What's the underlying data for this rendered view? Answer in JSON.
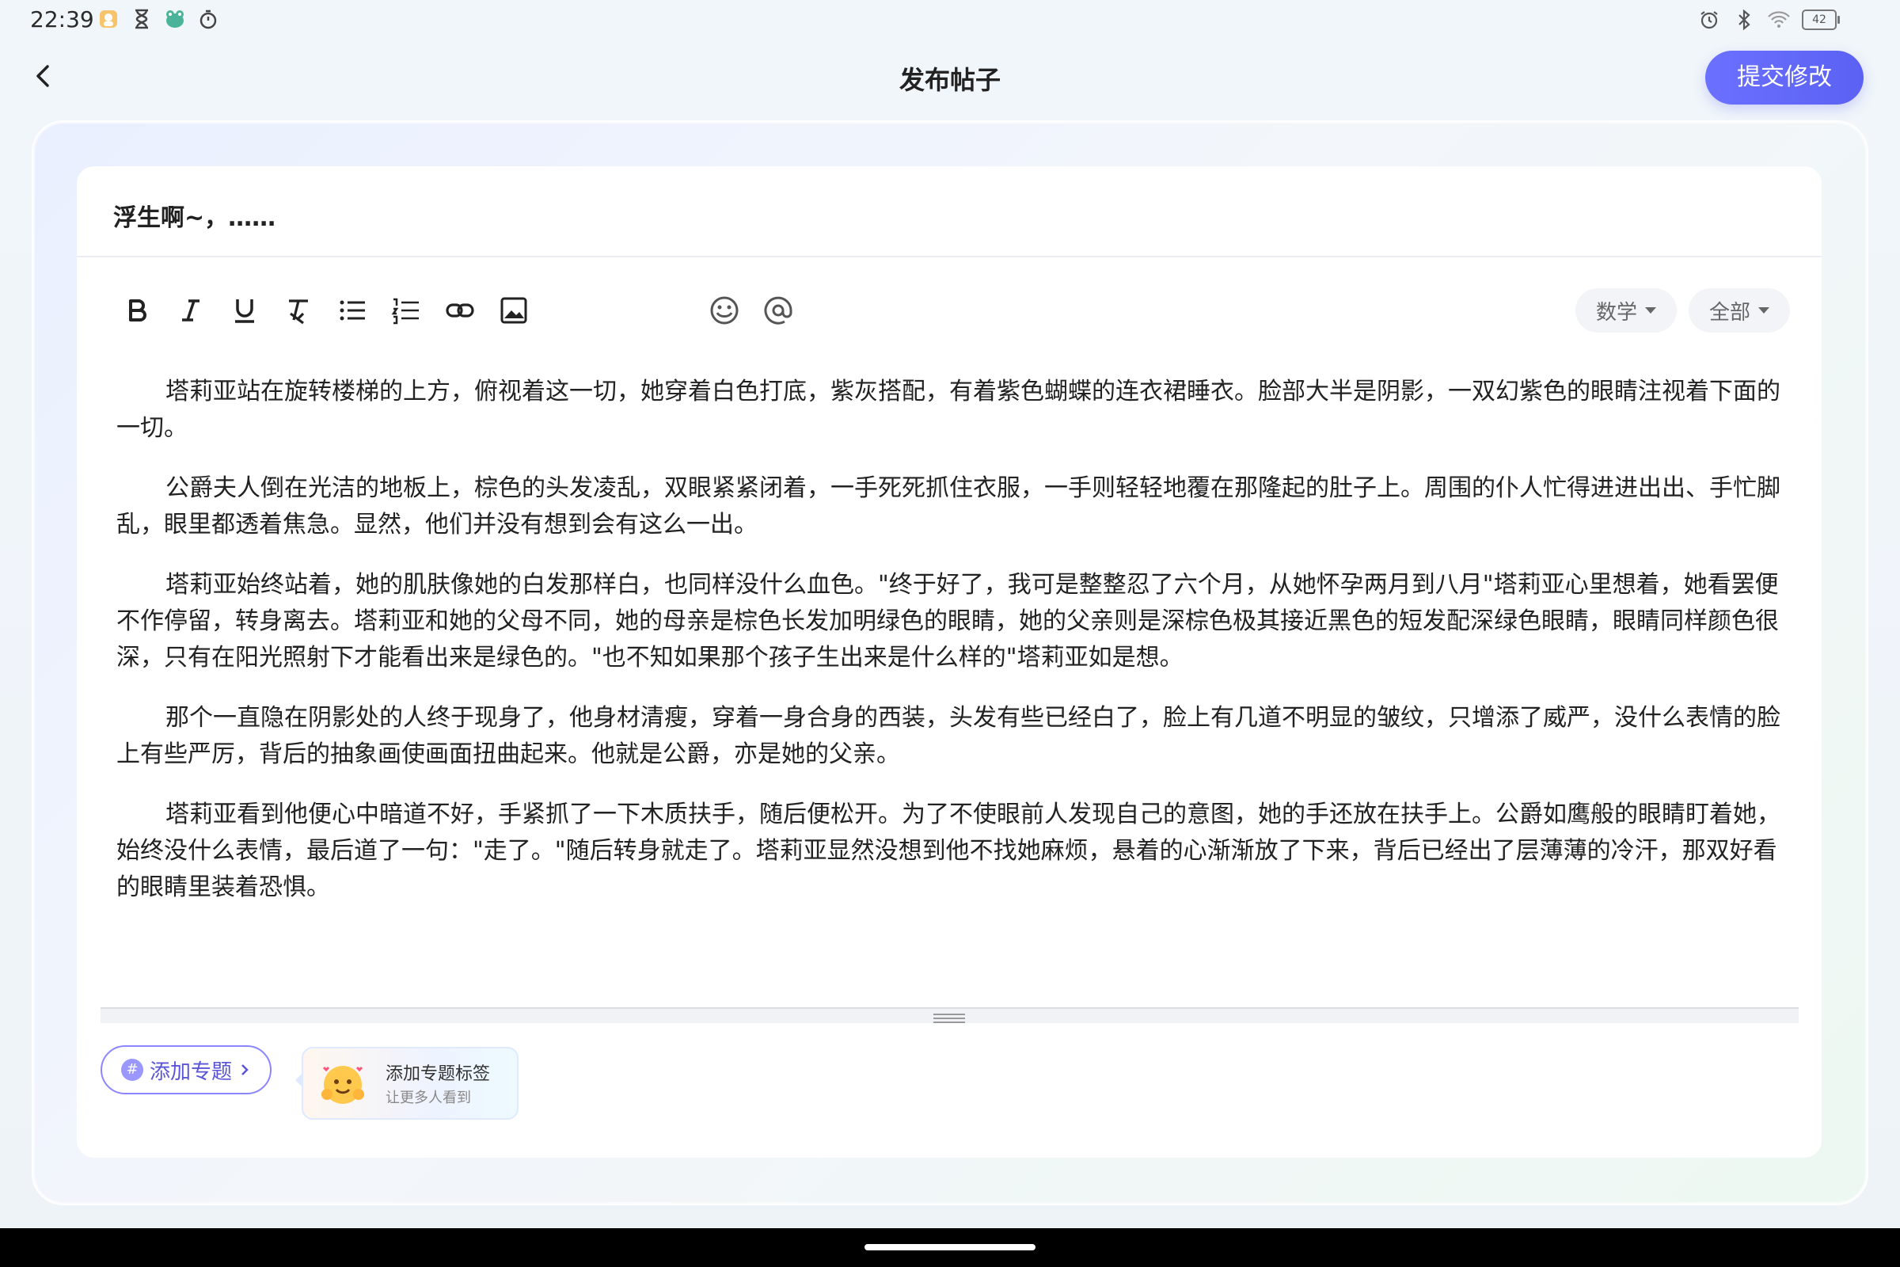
{
  "status": {
    "time": "22:39",
    "battery": "42",
    "left_icons": [
      "app-notification-icon",
      "hourglass-icon",
      "frog-icon",
      "timer-icon"
    ],
    "right_icons": [
      "alarm-icon",
      "bluetooth-icon",
      "wifi-icon",
      "battery-icon"
    ]
  },
  "header": {
    "title": "发布帖子",
    "submit_label": "提交修改"
  },
  "post": {
    "title": "浮生啊~，……",
    "paragraphs": [
      "塔莉亚站在旋转楼梯的上方，俯视着这一切，她穿着白色打底，紫灰搭配，有着紫色蝴蝶的连衣裙睡衣。脸部大半是阴影，一双幻紫色的眼睛注视着下面的一切。",
      "公爵夫人倒在光洁的地板上，棕色的头发凌乱，双眼紧紧闭着，一手死死抓住衣服，一手则轻轻地覆在那隆起的肚子上。周围的仆人忙得进进出出、手忙脚乱，眼里都透着焦急。显然，他们并没有想到会有这么一出。",
      "塔莉亚始终站着，她的肌肤像她的白发那样白，也同样没什么血色。\"终于好了，我可是整整忍了六个月，从她怀孕两月到八月\"塔莉亚心里想着，她看罢便不作停留，转身离去。塔莉亚和她的父母不同，她的母亲是棕色长发加明绿色的眼睛，她的父亲则是深棕色极其接近黑色的短发配深绿色眼睛，眼睛同样颜色很深，只有在阳光照射下才能看出来是绿色的。\"也不知如果那个孩子生出来是什么样的\"塔莉亚如是想。",
      "那个一直隐在阴影处的人终于现身了，他身材清瘦，穿着一身合身的西装，头发有些已经白了，脸上有几道不明显的皱纹，只增添了威严，没什么表情的脸上有些严厉，背后的抽象画使画面扭曲起来。他就是公爵，亦是她的父亲。",
      "塔莉亚看到他便心中暗道不好，手紧抓了一下木质扶手，随后便松开。为了不使眼前人发现自己的意图，她的手还放在扶手上。公爵如鹰般的眼睛盯着她，始终没什么表情，最后道了一句：\"走了。\"随后转身就走了。塔莉亚显然没想到他不找她麻烦，悬着的心渐渐放了下来，背后已经出了层薄薄的冷汗，那双好看的眼睛里装着恐惧。"
    ]
  },
  "toolbar": {
    "tools": [
      "bold-icon",
      "italic-icon",
      "underline-icon",
      "clear-format-icon",
      "bullet-list-icon",
      "numbered-list-icon",
      "link-icon",
      "image-icon",
      "emoji-icon",
      "mention-icon"
    ],
    "category_chip": "数学",
    "scope_chip": "全部"
  },
  "topic": {
    "add_topic_label": "添加专题",
    "tag_title": "添加专题标签",
    "tag_subtitle": "让更多人看到"
  },
  "colors": {
    "accent": "#5b61f2",
    "topic_border": "#8b86ff"
  }
}
